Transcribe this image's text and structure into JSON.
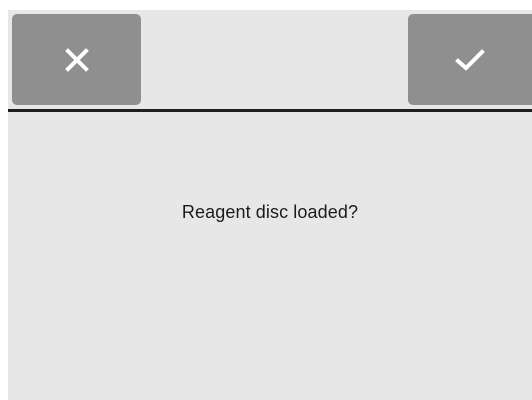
{
  "dialog": {
    "message": "Reagent disc loaded?",
    "cancel_icon": "close-icon",
    "confirm_icon": "checkmark-icon"
  },
  "colors": {
    "background": "#e7e7e7",
    "button": "#8f8f8f",
    "icon": "#ffffff",
    "divider": "#1e1e1e",
    "text": "#1b1b1b"
  }
}
